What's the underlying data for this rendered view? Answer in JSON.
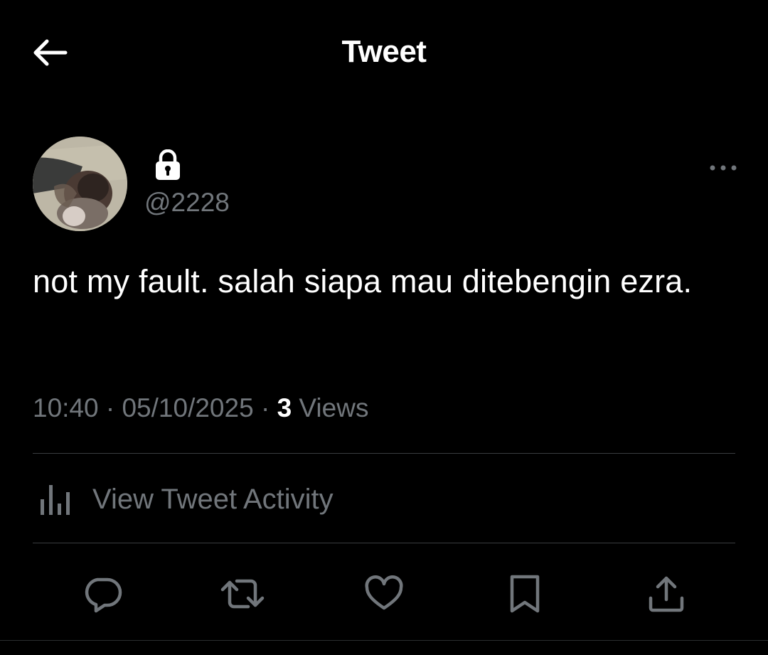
{
  "header": {
    "title": "Tweet",
    "back_icon": "arrow-left-icon"
  },
  "author": {
    "handle": "@2228",
    "protected_icon": "lock-icon",
    "avatar": "profile-photo"
  },
  "tweet": {
    "text": "not my fault. salah siapa mau ditebengin ezra.",
    "time": "10:40",
    "date": "05/10/2025",
    "separator": "·",
    "views_count": "3",
    "views_label": "Views"
  },
  "activity": {
    "label": "View Tweet Activity",
    "icon": "bar-chart-icon"
  },
  "actions": [
    {
      "name": "reply",
      "icon": "reply-icon"
    },
    {
      "name": "retweet",
      "icon": "retweet-icon"
    },
    {
      "name": "like",
      "icon": "heart-icon"
    },
    {
      "name": "bookmark",
      "icon": "bookmark-icon"
    },
    {
      "name": "share",
      "icon": "share-icon"
    }
  ],
  "colors": {
    "background": "#000000",
    "primary_text": "#ffffff",
    "secondary_text": "#71767b",
    "divider": "#3a3d40",
    "icon": "#71767b"
  }
}
